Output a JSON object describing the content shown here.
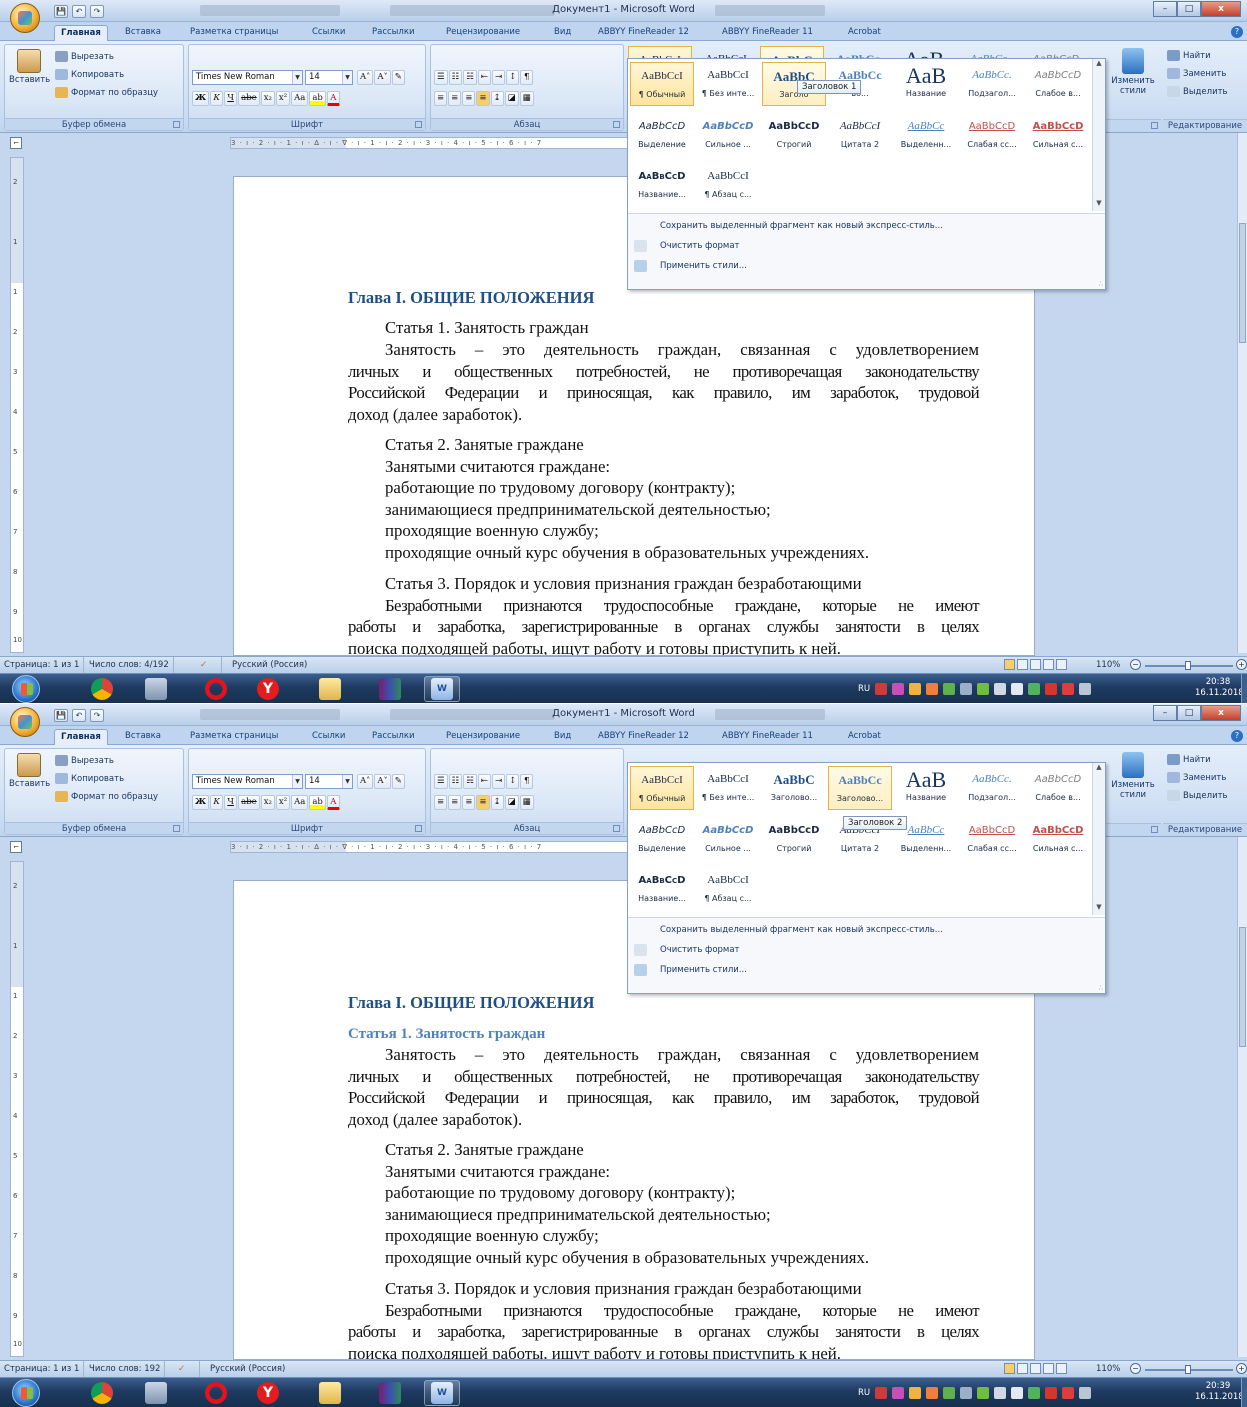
{
  "screens": [
    {
      "window_title": "Документ1 - Microsoft Word",
      "qat": [
        "💾",
        "↶",
        "↷"
      ],
      "tabs": [
        "Главная",
        "Вставка",
        "Разметка страницы",
        "Ссылки",
        "Рассылки",
        "Рецензирование",
        "Вид",
        "ABBYY FineReader 12",
        "ABBYY FineReader 11",
        "Acrobat"
      ],
      "active_tab": "Главная",
      "clipboard": {
        "paste": "Вставить",
        "cut": "Вырезать",
        "copy": "Копировать",
        "format_painter": "Формат по образцу",
        "caption": "Буфер обмена"
      },
      "font": {
        "name": "Times New Roman",
        "size": "14",
        "caption": "Шрифт",
        "bold": "Ж",
        "italic": "К",
        "underline": "Ч",
        "strike": "abe",
        "sub": "x₂",
        "sup": "x²",
        "case": "Aa",
        "grow": "A˄",
        "shrink": "A˅"
      },
      "paragraph": {
        "caption": "Абзац"
      },
      "styles_gallery": [
        {
          "preview": "AaBbCcI",
          "name": "¶ Обычный"
        },
        {
          "preview": "AaBbCcI",
          "name": "¶ Без инте..."
        },
        {
          "preview": "AaBbC",
          "name": "Заголово..."
        },
        {
          "preview": "AaBbCc",
          "name": "Заголово..."
        },
        {
          "preview": "AaB",
          "name": "Название"
        },
        {
          "preview": "AaBbCc.",
          "name": "Подзагол..."
        },
        {
          "preview": "AaBbCcD",
          "name": "Слабое в..."
        },
        {
          "preview": "AaBbCcD",
          "name": "Выделение"
        },
        {
          "preview": "AaBbCcD",
          "name": "Сильное ..."
        },
        {
          "preview": "AaBbCcD",
          "name": "Строгий"
        },
        {
          "preview": "AaBbCcI",
          "name": "Цитата 2"
        },
        {
          "preview": "AaBbCc",
          "name": "Выделенн..."
        },
        {
          "preview": "AaBbCcD",
          "name": "Слабая сс..."
        },
        {
          "preview": "AaBbCcD",
          "name": "Сильная с..."
        },
        {
          "preview": "AaBbCcD",
          "name": "Название..."
        },
        {
          "preview": "AaBbCcI",
          "name": "¶ Абзац с..."
        }
      ],
      "gallery_third_name": "Заголо",
      "gallery_fourth_name": "Заголовок 1",
      "gallery_fifth_name_suffix": "во...",
      "tooltip": "Заголовок 1",
      "gallery_menu": {
        "save": "Сохранить выделенный фрагмент как новый экспресс-стиль...",
        "clear": "Очистить формат",
        "apply": "Применить стили..."
      },
      "change_styles": "Изменить стили",
      "editing": {
        "find": "Найти",
        "replace": "Заменить",
        "select": "Выделить",
        "caption": "Редактирование"
      },
      "ruler_text": "3 · ı · 2 · ı · 1 · ı · ∆ · ı · ∇ · ı · 1 · ı · 2 · ı · 3 · ı · 4 · ı · 5 · ı · 6 · ı · 7",
      "vruler": [
        "2",
        "1",
        "1",
        "2",
        "3",
        "4",
        "5",
        "6",
        "7",
        "8",
        "9",
        "10"
      ],
      "doc": {
        "chapter": "Глава I. ОБЩИЕ ПОЛОЖЕНИЯ",
        "art1_title": "Статья 1. Занятость граждан",
        "art1_lines": [
          "Занятость – это деятельность граждан, связанная с удовлетворением",
          "личных и общественных потребностей, не противоречащая законодательству",
          "Российской Федерации и приносящая, как правило, им заработок, трудовой",
          "доход (далее заработок)."
        ],
        "art2_lines": [
          "Статья 2. Занятые граждане",
          "Занятыми считаются граждане:",
          "работающие по трудовому договору (контракту);",
          "занимающиеся предпринимательской деятельностью;",
          "проходящие военную службу;",
          "проходящие очный курс обучения в образовательных учреждениях."
        ],
        "art3_lines": [
          "Статья 3. Порядок и условия признания граждан безработающими",
          "Безработными признаются трудоспособные граждане, которые не имеют",
          "работы и заработка, зарегистрированные в органах службы занятости в целях",
          "поиска подходящей работы, ищут работу и готовы приступить к ней."
        ]
      },
      "status": {
        "page": "Страница: 1 из 1",
        "words": "Число слов: 4/192",
        "lang": "Русский (Россия)",
        "zoom": "110%"
      },
      "taskbar": {
        "lang": "RU",
        "time": "20:38",
        "date": "16.11.2018"
      }
    },
    {
      "window_title": "Документ1 - Microsoft Word",
      "gallery_third_name": "Заголово...",
      "gallery_fourth_name": "Заголово...",
      "tooltip": "Заголовок 2",
      "doc_art1_heading": "Статья 1. Занятость граждан",
      "status": {
        "page": "Страница: 1 из 1",
        "words": "Число слов: 192",
        "lang": "Русский (Россия)",
        "zoom": "110%"
      },
      "taskbar": {
        "lang": "RU",
        "time": "20:39",
        "date": "16.11.2018"
      }
    }
  ],
  "colors": {
    "heading1": "#1f4f83",
    "heading2": "#4f81bd",
    "ribbon": "#c4d7ee",
    "taskbar": "#1f3a61",
    "selection": "#ffe49c"
  }
}
